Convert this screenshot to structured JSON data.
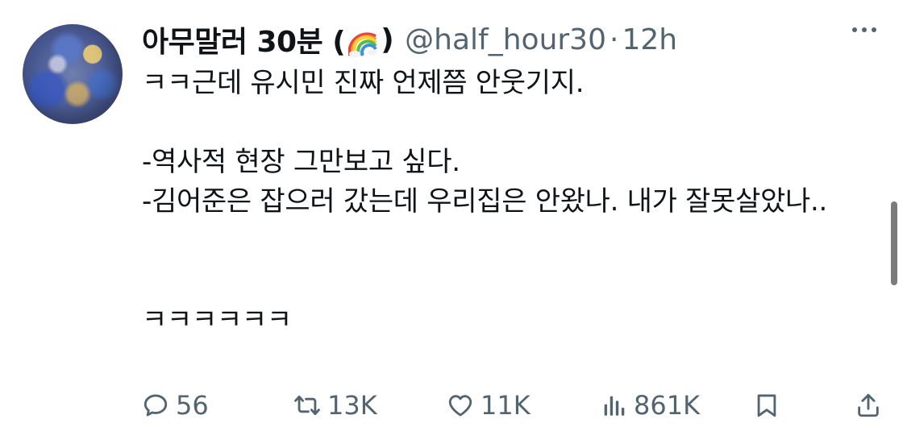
{
  "tweet": {
    "author_name": "아무말러 30분 (",
    "author_name_close": ")",
    "author_emoji": "rainbow-emoji",
    "handle": "@half_hour30",
    "separator": "·",
    "time": "12h",
    "text": "ㅋㅋ근데 유시민 진짜 언제쯤 안웃기지.\n\n-역사적 현장 그만보고 싶다.\n-김어준은 잡으러 갔는데 우리집은 안왔나. 내가 잘못살았나..\n\n\nㅋㅋㅋㅋㅋㅋ"
  },
  "actions": {
    "reply_count": "56",
    "retweet_count": "13K",
    "like_count": "11K",
    "view_count": "861K"
  },
  "icons": [
    "more-icon",
    "reply-icon",
    "retweet-icon",
    "like-icon",
    "views-icon",
    "bookmark-icon",
    "share-icon"
  ],
  "colors": {
    "text": "#0f1419",
    "secondary": "#536471",
    "background": "#ffffff"
  }
}
